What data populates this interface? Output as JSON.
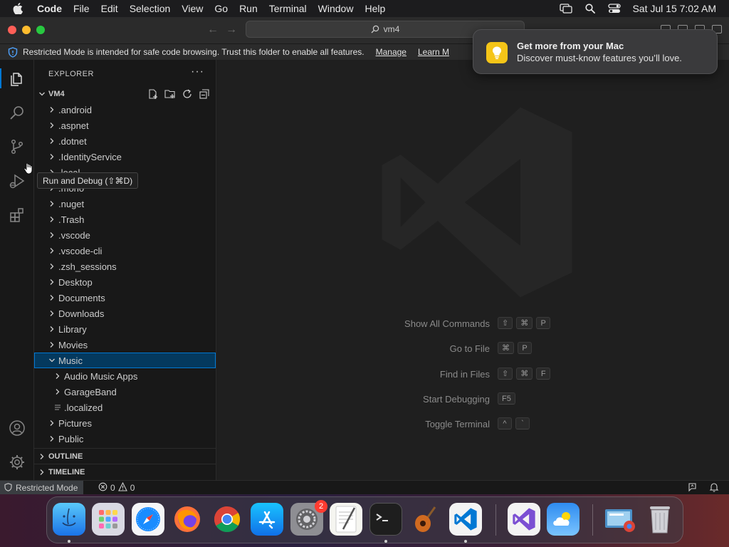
{
  "menubar": {
    "app": "Code",
    "items": [
      "File",
      "Edit",
      "Selection",
      "View",
      "Go",
      "Run",
      "Terminal",
      "Window",
      "Help"
    ],
    "clock": "Sat Jul 15  7:02 AM"
  },
  "titlebar": {
    "search_text": "vm4"
  },
  "banner": {
    "message": "Restricted Mode is intended for safe code browsing. Trust this folder to enable all features.",
    "manage": "Manage",
    "learn_more": "Learn M"
  },
  "notification": {
    "title": "Get more from your Mac",
    "body": "Discover must-know features you’ll love."
  },
  "sidebar": {
    "header": "EXPLORER",
    "more": "···",
    "root": "VM4",
    "tree": [
      {
        "label": ".android",
        "expanded": false
      },
      {
        "label": ".aspnet",
        "expanded": false
      },
      {
        "label": ".dotnet",
        "expanded": false
      },
      {
        "label": ".IdentityService",
        "expanded": false
      },
      {
        "label": ".local",
        "expanded": false
      },
      {
        "label": ".mono",
        "expanded": false
      },
      {
        "label": ".nuget",
        "expanded": false
      },
      {
        "label": ".Trash",
        "expanded": false
      },
      {
        "label": ".vscode",
        "expanded": false
      },
      {
        "label": ".vscode-cli",
        "expanded": false
      },
      {
        "label": ".zsh_sessions",
        "expanded": false
      },
      {
        "label": "Desktop",
        "expanded": false
      },
      {
        "label": "Documents",
        "expanded": false
      },
      {
        "label": "Downloads",
        "expanded": false
      },
      {
        "label": "Library",
        "expanded": false
      },
      {
        "label": "Movies",
        "expanded": false
      },
      {
        "label": "Music",
        "expanded": true,
        "selected": true
      },
      {
        "label": "Audio Music Apps",
        "expanded": false,
        "child": true
      },
      {
        "label": "GarageBand",
        "expanded": false,
        "child": true
      },
      {
        "label": ".localized",
        "file": true,
        "child": true
      },
      {
        "label": "Pictures",
        "expanded": false
      },
      {
        "label": "Public",
        "expanded": false
      }
    ],
    "outline": "OUTLINE",
    "timeline": "TIMELINE"
  },
  "tooltip": "Run and Debug (⇧⌘D)",
  "editor": {
    "hints": [
      {
        "label": "Show All Commands",
        "keys": [
          "⇧",
          "⌘",
          "P"
        ]
      },
      {
        "label": "Go to File",
        "keys": [
          "⌘",
          "P"
        ]
      },
      {
        "label": "Find in Files",
        "keys": [
          "⇧",
          "⌘",
          "F"
        ]
      },
      {
        "label": "Start Debugging",
        "keys": [
          "F5"
        ]
      },
      {
        "label": "Toggle Terminal",
        "keys": [
          "^",
          "`"
        ]
      }
    ]
  },
  "statusbar": {
    "restricted": "Restricted Mode",
    "errors": "0",
    "warnings": "0"
  },
  "dock": {
    "apps": [
      "finder",
      "launchpad",
      "safari",
      "firefox",
      "chrome",
      "app-store",
      "system-settings",
      "textedit",
      "terminal",
      "garageband",
      "vscode",
      "visual-studio",
      "weather",
      "downloads-stack",
      "trash"
    ],
    "settings_badge": "2"
  },
  "colors": {
    "accent": "#0078d4",
    "selection": "#04395e"
  }
}
